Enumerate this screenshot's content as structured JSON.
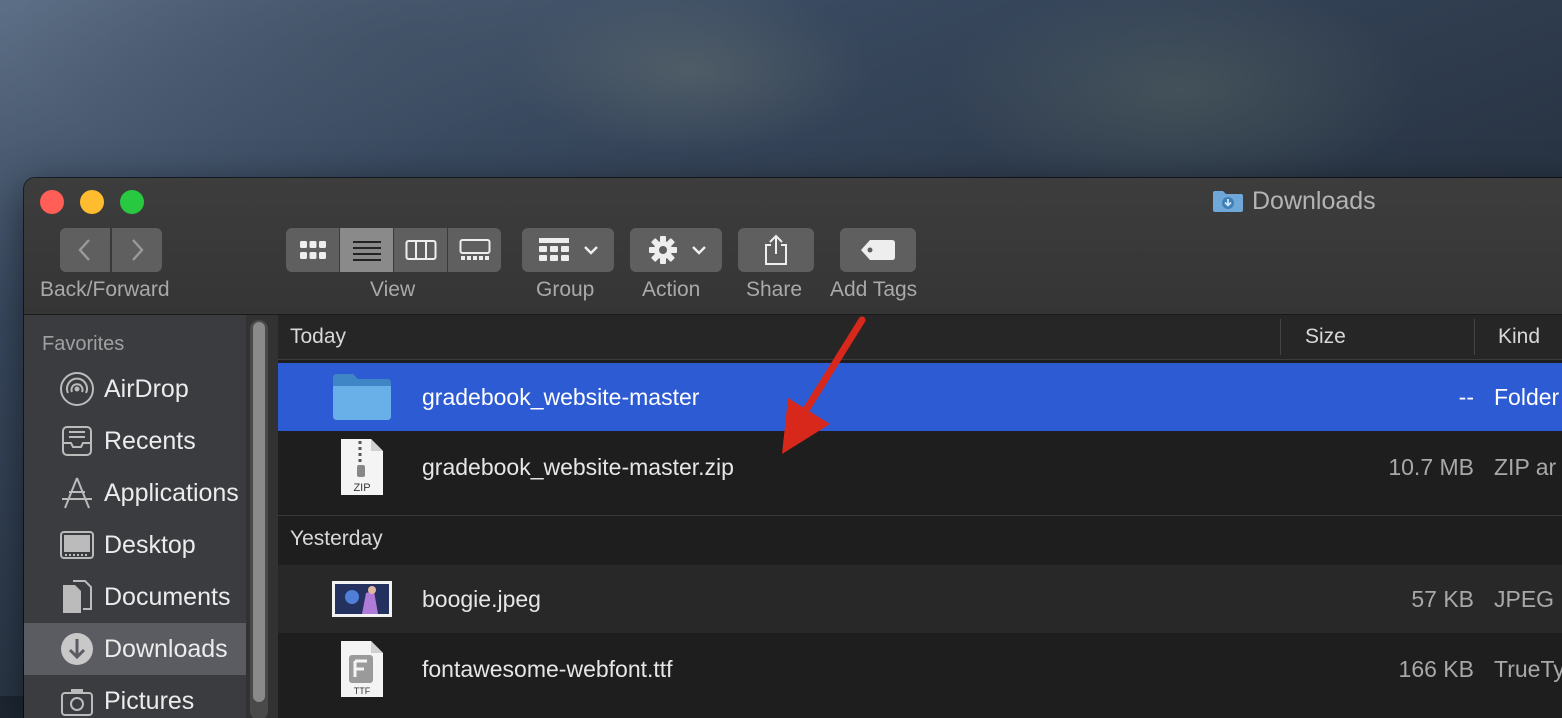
{
  "window": {
    "title": "Downloads"
  },
  "toolbar": {
    "back_forward_label": "Back/Forward",
    "view_label": "View",
    "group_label": "Group",
    "action_label": "Action",
    "share_label": "Share",
    "add_tags_label": "Add Tags"
  },
  "sidebar": {
    "heading": "Favorites",
    "items": [
      {
        "label": "AirDrop",
        "icon": "airdrop-icon"
      },
      {
        "label": "Recents",
        "icon": "recents-icon"
      },
      {
        "label": "Applications",
        "icon": "applications-icon"
      },
      {
        "label": "Desktop",
        "icon": "desktop-icon"
      },
      {
        "label": "Documents",
        "icon": "documents-icon"
      },
      {
        "label": "Downloads",
        "icon": "downloads-icon",
        "active": true
      },
      {
        "label": "Pictures",
        "icon": "pictures-icon"
      }
    ]
  },
  "columns": {
    "name": "Today",
    "size": "Size",
    "kind": "Kind"
  },
  "groups": [
    {
      "label": "Today",
      "files": [
        {
          "name": "gradebook_website-master",
          "size": "--",
          "kind": "Folder",
          "icon": "folder-icon",
          "selected": true
        },
        {
          "name": "gradebook_website-master.zip",
          "size": "10.7 MB",
          "kind": "ZIP ar",
          "icon": "zip-file-icon",
          "icon_text": "ZIP"
        }
      ]
    },
    {
      "label": "Yesterday",
      "files": [
        {
          "name": "boogie.jpeg",
          "size": "57 KB",
          "kind": "JPEG",
          "icon": "image-thumbnail-icon"
        },
        {
          "name": "fontawesome-webfont.ttf",
          "size": "166 KB",
          "kind": "TrueTy",
          "icon": "font-file-icon",
          "icon_text": "TTF"
        }
      ]
    }
  ],
  "colors": {
    "selection": "#2d5bd3",
    "annotation_arrow": "#d8281c",
    "close": "#ff5f57",
    "minimize": "#febc2e",
    "maximize": "#28c840"
  }
}
